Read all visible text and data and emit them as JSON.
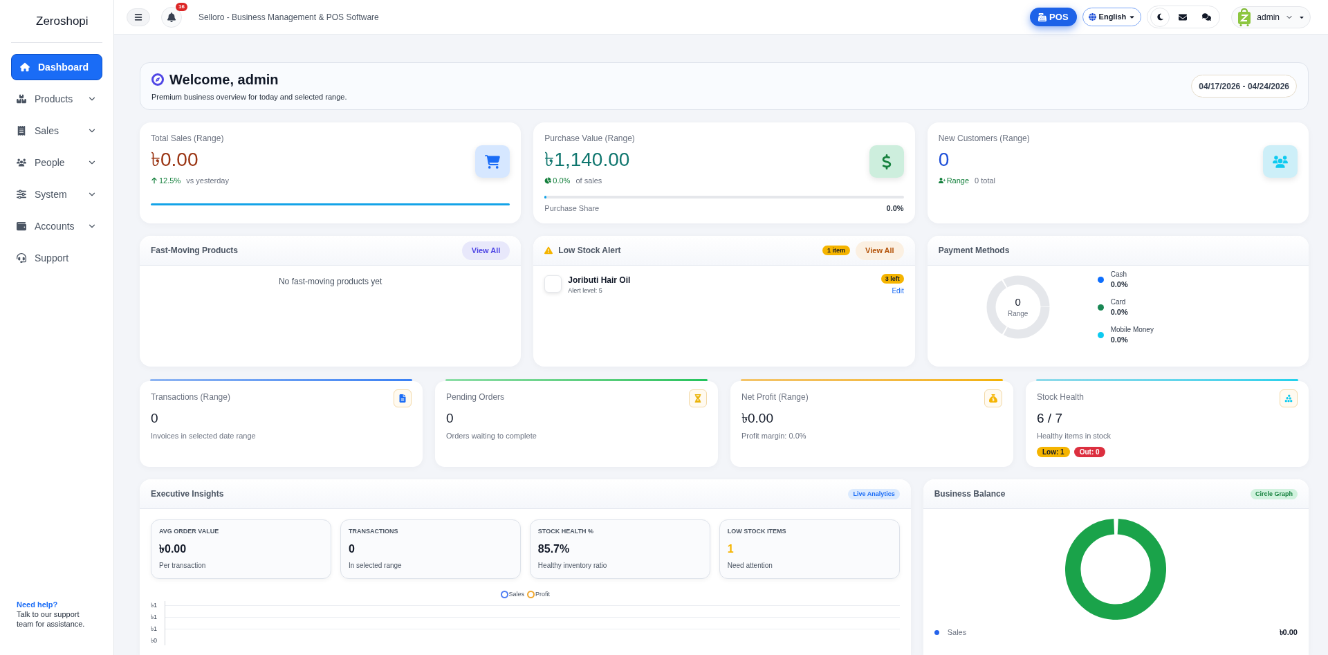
{
  "sidebar": {
    "brand": "Zeroshopi",
    "items": [
      {
        "kind": "dashboard",
        "label": "Dashboard",
        "selected": true,
        "expandable": false
      },
      {
        "kind": "products",
        "label": "Products",
        "selected": false,
        "expandable": true
      },
      {
        "kind": "sales",
        "label": "Sales",
        "selected": false,
        "expandable": true
      },
      {
        "kind": "people",
        "label": "People",
        "selected": false,
        "expandable": true
      },
      {
        "kind": "system",
        "label": "System",
        "selected": false,
        "expandable": true
      },
      {
        "kind": "accounts",
        "label": "Accounts",
        "selected": false,
        "expandable": true
      },
      {
        "kind": "support",
        "label": "Support",
        "selected": false,
        "expandable": false
      }
    ],
    "help": {
      "title": "Need help?",
      "text": "Talk to our support team for assistance."
    }
  },
  "topbar": {
    "notification_count": "16",
    "title": "Selloro - Business Management & POS Software",
    "pos_label": "POS",
    "language": "English",
    "user": "admin"
  },
  "welcome": {
    "title": "Welcome, admin",
    "subtitle": "Premium business overview for today and selected range.",
    "date_range": "04/17/2026 - 04/24/2026"
  },
  "stats": [
    {
      "kind": "sales",
      "label": "Total Sales (Range)",
      "value": "৳0.00",
      "note_value": "12.5%",
      "note": "vs yesterday"
    },
    {
      "kind": "purchase",
      "label": "Purchase Value (Range)",
      "value": "৳1,140.00",
      "note_value": "0.0%",
      "note": "of sales",
      "level": 0,
      "bar_label": "Purchase Share",
      "bar_reading": "0.0%"
    },
    {
      "kind": "customers",
      "label": "New Customers (Range)",
      "value": "0",
      "note_value": "Range",
      "note": "0 total"
    }
  ],
  "fast_moving": {
    "title": "Fast-Moving Products",
    "view_all": "View All",
    "empty_text": "No fast-moving products yet"
  },
  "low_stock": {
    "title": "Low Stock Alert",
    "count_badge": "1 item",
    "view_all": "View All",
    "items": [
      {
        "name": "Joributi Hair Oil",
        "alert": "Alert level: 5",
        "left": "3 left",
        "action": "Edit"
      }
    ]
  },
  "payment_methods": {
    "title": "Payment Methods",
    "total": "0",
    "total_label": "Range",
    "methods": [
      {
        "name": "Cash",
        "percent": "0.0%",
        "color": "#0d6efd"
      },
      {
        "name": "Card",
        "percent": "0.0%",
        "color": "#198754"
      },
      {
        "name": "Mobile Money",
        "percent": "0.0%",
        "color": "#0dcaf0"
      }
    ]
  },
  "metrics": [
    {
      "kind": "transactions",
      "label": "Transactions (Range)",
      "value": "0",
      "note": "Invoices in selected date range"
    },
    {
      "kind": "pending",
      "label": "Pending Orders",
      "value": "0",
      "note": "Orders waiting to complete"
    },
    {
      "kind": "profit",
      "label": "Net Profit (Range)",
      "value": "৳0.00",
      "note": "Profit margin: 0.0%"
    },
    {
      "kind": "stock",
      "label": "Stock Health",
      "value": "6 / 7",
      "note": "Healthy items in stock",
      "badges": [
        {
          "kind": "low",
          "label": "Low: 1"
        },
        {
          "kind": "out",
          "label": "Out: 0"
        }
      ]
    }
  ],
  "insights": {
    "title": "Executive Insights",
    "badge": "Live Analytics",
    "cards": [
      {
        "label": "AVG ORDER VALUE",
        "value": "৳0.00",
        "note": "Per transaction",
        "kind": "normal"
      },
      {
        "label": "TRANSACTIONS",
        "value": "0",
        "note": "In selected range",
        "kind": "normal"
      },
      {
        "label": "STOCK HEALTH %",
        "value": "85.7%",
        "note": "Healthy inventory ratio",
        "kind": "normal"
      },
      {
        "label": "LOW STOCK ITEMS",
        "value": "1",
        "note": "Need attention",
        "kind": "warning"
      }
    ],
    "chart": {
      "legend": [
        {
          "name": "Sales",
          "color": "#4f7df3"
        },
        {
          "name": "Profit",
          "color": "#f0a830"
        }
      ],
      "y_labels": [
        "৳1",
        "৳1",
        "৳1",
        "৳0"
      ]
    }
  },
  "business_balance": {
    "title": "Business Balance",
    "badge": "Circle Graph",
    "legend": [
      {
        "name": "Sales",
        "value": "৳0.00",
        "color": "#2563eb"
      }
    ]
  }
}
